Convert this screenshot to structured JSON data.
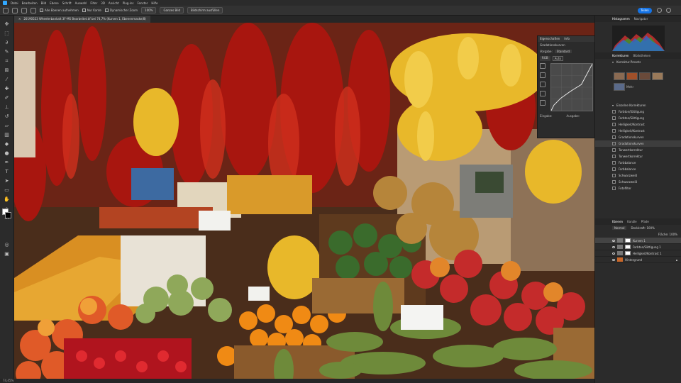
{
  "menubar": {
    "items": [
      "Datei",
      "Bearbeiten",
      "Bild",
      "Ebene",
      "Schrift",
      "Auswahl",
      "Filter",
      "3D",
      "Ansicht",
      "Plug-ins",
      "Fenster",
      "Hilfe"
    ]
  },
  "options": {
    "sample_all_layers": "Alle Ebenen aufnehmen",
    "hard_edge": "Nur Kante",
    "dynamic_zoom": "Dynamischer Zoom",
    "zoom_pct": "100%",
    "fit_screen": "Ganzes Bild",
    "fill_screen": "Bildschirm ausfüllen",
    "share_label": "Teilen"
  },
  "document": {
    "tab_label": "20190523 Wheelerbankalt 3F-MS Bearbeitet.tif bei 74,7% (Kurven 1, Ebenenmaske/8)",
    "status": "74,45%"
  },
  "curves_panel": {
    "tab1": "Eigenschaften",
    "tab2": "Info",
    "title": "Gradationskurven",
    "preset_label": "Vorgabe:",
    "preset_value": "Standard",
    "channel_value": "RGB",
    "auto_label": "Auto",
    "input_label": "Eingabe:",
    "output_label": "Ausgabe:"
  },
  "histogram": {
    "tab1": "Histogramm",
    "tab2": "Navigator"
  },
  "adjustments": {
    "tab1": "Korrekturen",
    "tab2": "Bibliotheken",
    "presets_label": "Korrektur-Presets",
    "more_label": "Mehr",
    "single_label": "Einzelne Korrekturen",
    "items": [
      "Farbton/Sättigung",
      "Farbton/Sättigung",
      "Helligkeit/Kontrast",
      "Helligkeit/Kontrast",
      "Gradationskurven",
      "Gradationskurven",
      "Tonwertkorrektur",
      "Tonwertkorrektur",
      "Farbbalance",
      "Farbbalance",
      "Schwarzweiß",
      "Schwarzweiß",
      "Fotofilter"
    ],
    "selected_index": 5
  },
  "layers": {
    "tabs": [
      "Ebenen",
      "Kanäle",
      "Pfade"
    ],
    "blend_mode": "Normal",
    "opacity": "Deckkraft: 100%",
    "fill": "Fläche: 100%",
    "rows": [
      {
        "name": "Kurven 1",
        "selected": true,
        "type": "adj"
      },
      {
        "name": "Farbton/Sättigung 1",
        "selected": false,
        "type": "adj"
      },
      {
        "name": "Helligkeit/Kontrast 1",
        "selected": false,
        "type": "adj"
      },
      {
        "name": "Hintergrund",
        "selected": false,
        "type": "img"
      }
    ]
  },
  "colors": {
    "accent": "#1473e6",
    "panel": "#2b2b2b"
  }
}
